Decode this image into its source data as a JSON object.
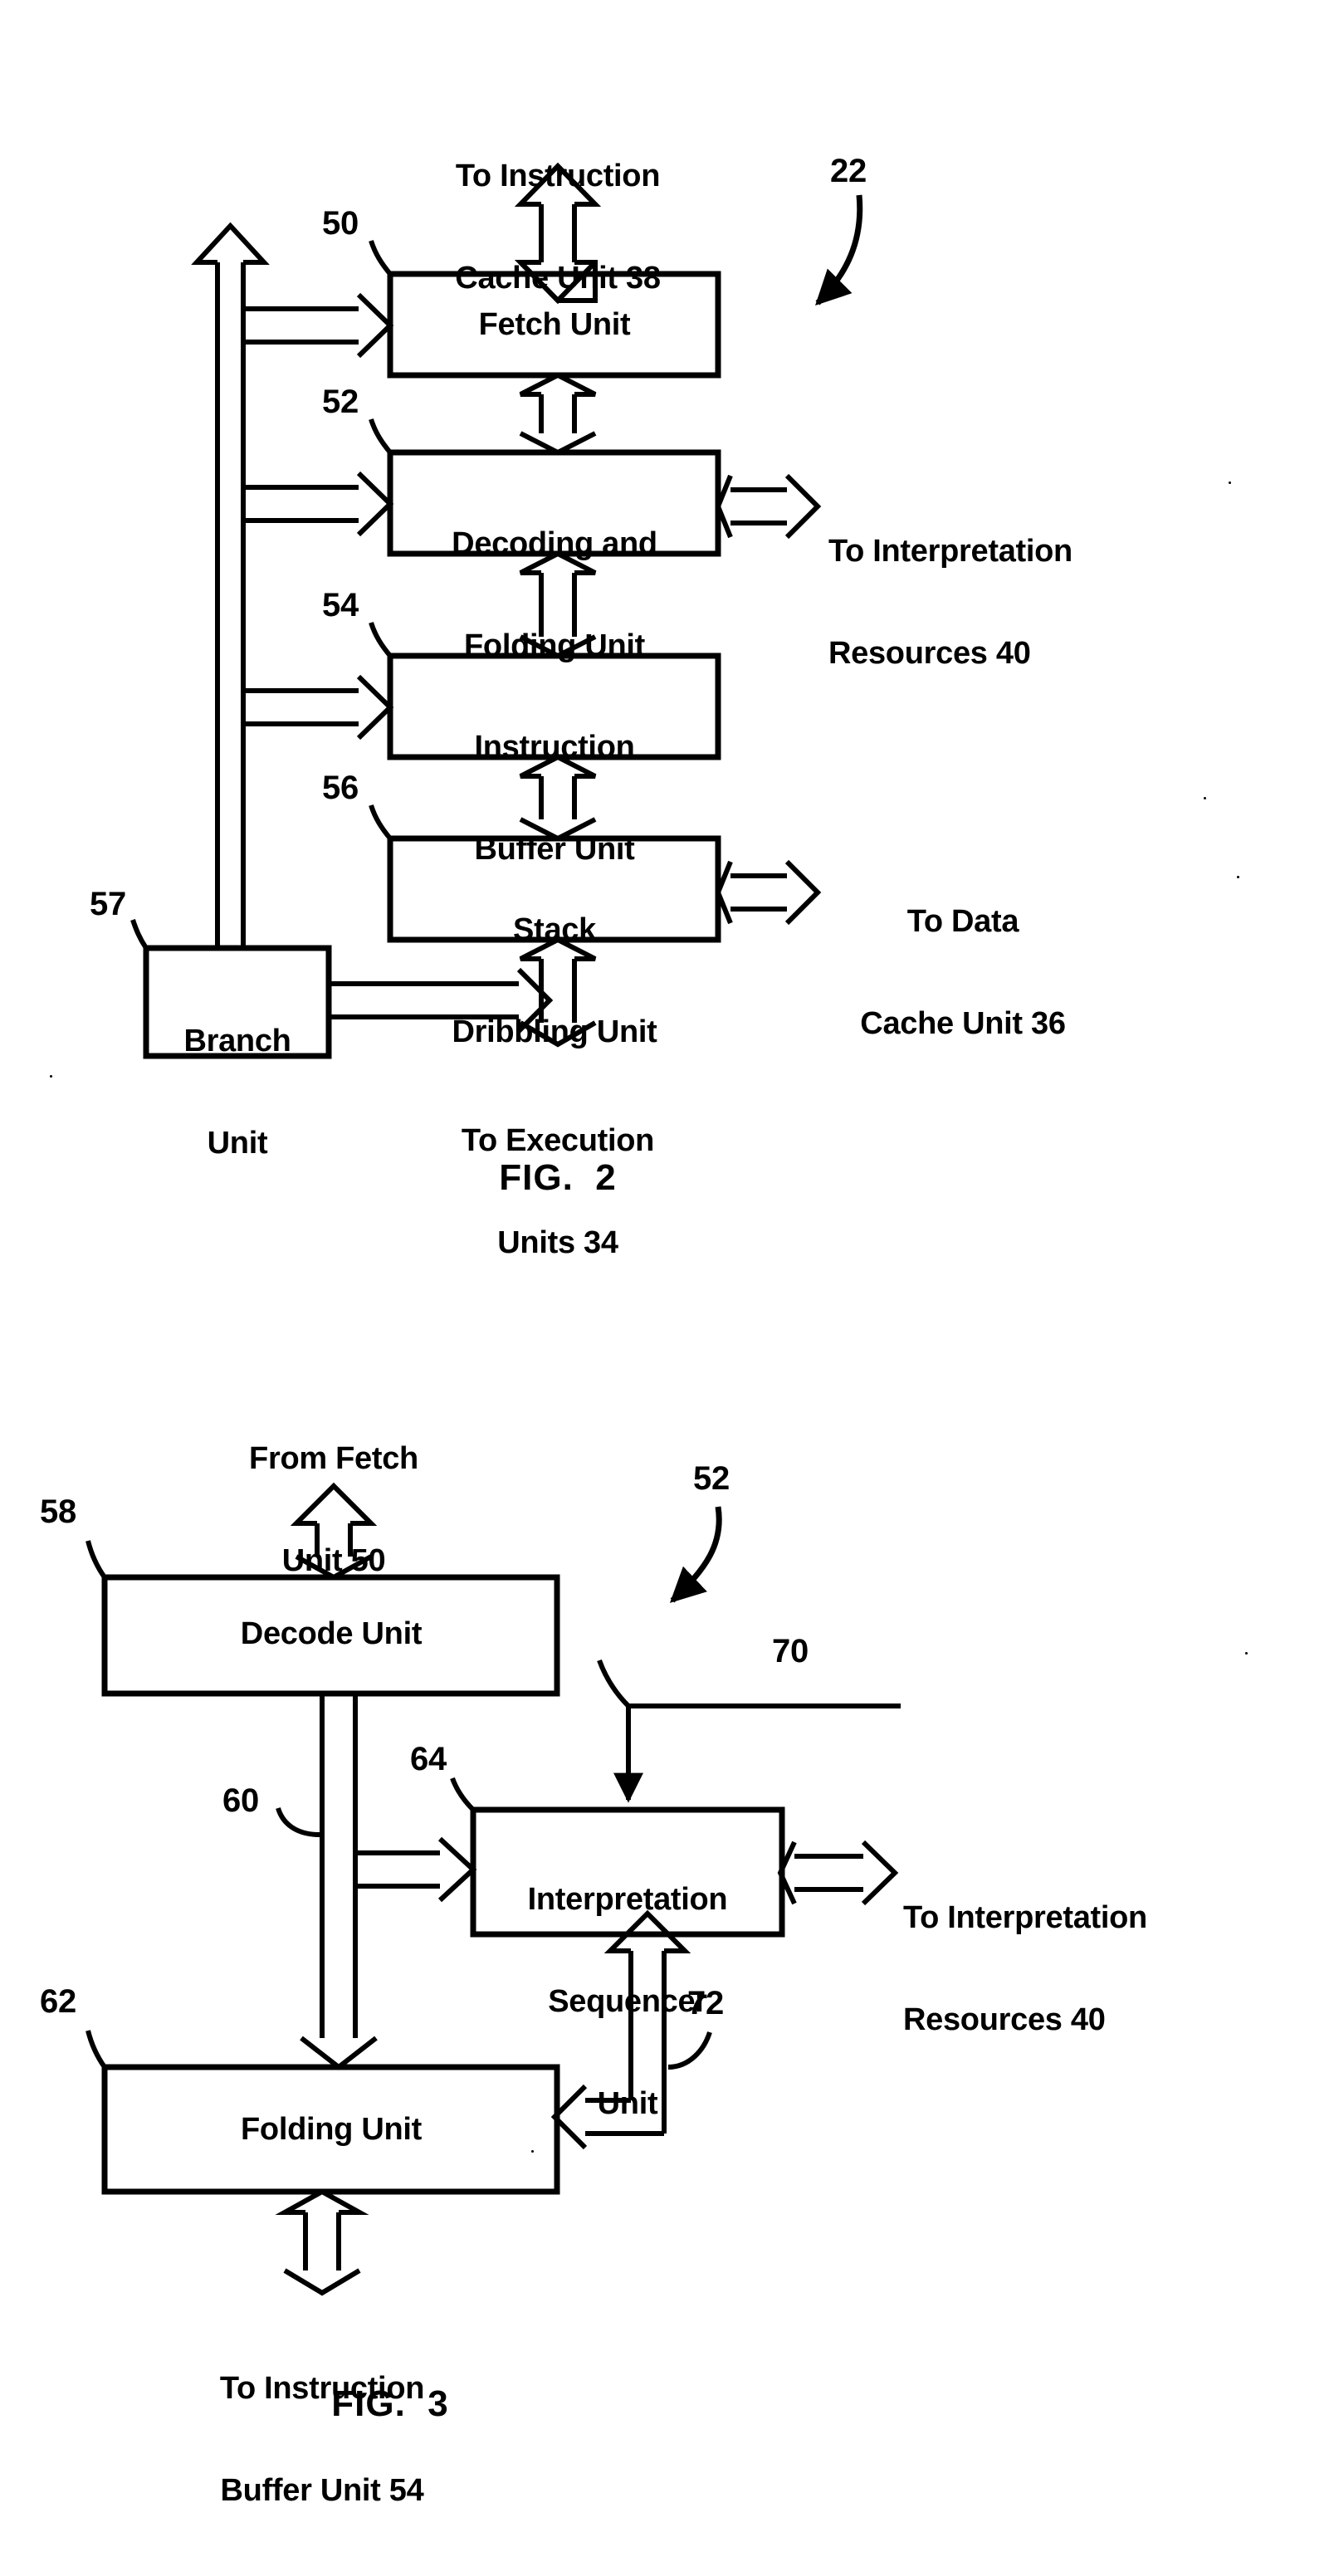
{
  "sheet": {
    "background": "#ffffff",
    "ink": "#000000"
  },
  "figures": [
    {
      "id": "fig2",
      "caption": "FIG.  2",
      "assembly_ref": "22",
      "blocks": [
        {
          "ref": "50",
          "label_line1": "Fetch Unit",
          "label_line2": ""
        },
        {
          "ref": "52",
          "label_line1": "Decoding and",
          "label_line2": "Folding Unit"
        },
        {
          "ref": "54",
          "label_line1": "Instruction",
          "label_line2": "Buffer Unit"
        },
        {
          "ref": "56",
          "label_line1": "Stack",
          "label_line2": "Dribbling Unit"
        },
        {
          "ref": "57",
          "label_line1": "Branch",
          "label_line2": "Unit"
        }
      ],
      "external_labels": [
        {
          "name": "to-instruction-cache",
          "line1": "To Instruction",
          "line2": "Cache Unit 38"
        },
        {
          "name": "to-interpretation-resources",
          "line1": "To Interpretation",
          "line2": "Resources 40"
        },
        {
          "name": "to-data-cache",
          "line1": "To Data",
          "line2": "Cache Unit 36"
        },
        {
          "name": "to-execution-units",
          "line1": "To Execution",
          "line2": "Units 34"
        }
      ]
    },
    {
      "id": "fig3",
      "caption": "FIG.  3",
      "assembly_ref": "52",
      "blocks": [
        {
          "ref": "58",
          "label_line1": "Decode Unit",
          "label_line2": ""
        },
        {
          "ref": "64",
          "label_line1": "Interpretation",
          "label_line2": "Sequencer",
          "label_line3": "Unit"
        },
        {
          "ref": "62",
          "label_line1": "Folding Unit",
          "label_line2": ""
        }
      ],
      "bus_refs": [
        {
          "ref": "60",
          "name": "decode-to-folding-bus"
        },
        {
          "ref": "70",
          "name": "incoming-control-line"
        },
        {
          "ref": "72",
          "name": "folding-sequencer-feedback"
        }
      ],
      "external_labels": [
        {
          "name": "from-fetch-unit",
          "line1": "From Fetch",
          "line2": "Unit 50"
        },
        {
          "name": "to-interpretation-resources",
          "line1": "To Interpretation",
          "line2": "Resources 40"
        },
        {
          "name": "to-instruction-buffer",
          "line1": "To Instruction",
          "line2": "Buffer Unit 54"
        }
      ]
    }
  ],
  "fig2_text": {
    "to_instruction_cache_1": "To Instruction",
    "to_instruction_cache_2": "Cache Unit 38",
    "ref_22": "22",
    "ref_50": "50",
    "fetch_unit": "Fetch Unit",
    "ref_52": "52",
    "decoding_1": "Decoding and",
    "decoding_2": "Folding Unit",
    "to_interp_1": "To Interpretation",
    "to_interp_2": "Resources 40",
    "ref_54": "54",
    "instruction_buffer_1": "Instruction",
    "instruction_buffer_2": "Buffer Unit",
    "ref_56": "56",
    "stack_1": "Stack",
    "stack_2": "Dribbling Unit",
    "to_data_1": "To Data",
    "to_data_2": "Cache Unit 36",
    "ref_57": "57",
    "branch_1": "Branch",
    "branch_2": "Unit",
    "to_exec_1": "To Execution",
    "to_exec_2": "Units 34",
    "caption": "FIG.  2"
  },
  "fig3_text": {
    "from_fetch_1": "From Fetch",
    "from_fetch_2": "Unit 50",
    "ref_58": "58",
    "decode_unit": "Decode Unit",
    "ref_52": "52",
    "ref_70": "70",
    "ref_60": "60",
    "ref_64": "64",
    "interp_1": "Interpretation",
    "interp_2": "Sequencer",
    "interp_3": "Unit",
    "to_interp_1": "To Interpretation",
    "to_interp_2": "Resources 40",
    "ref_62": "62",
    "ref_72": "72",
    "folding_unit": "Folding Unit",
    "to_instr_buf_1": "To Instruction",
    "to_instr_buf_2": "Buffer Unit 54",
    "caption": "FIG.  3"
  }
}
